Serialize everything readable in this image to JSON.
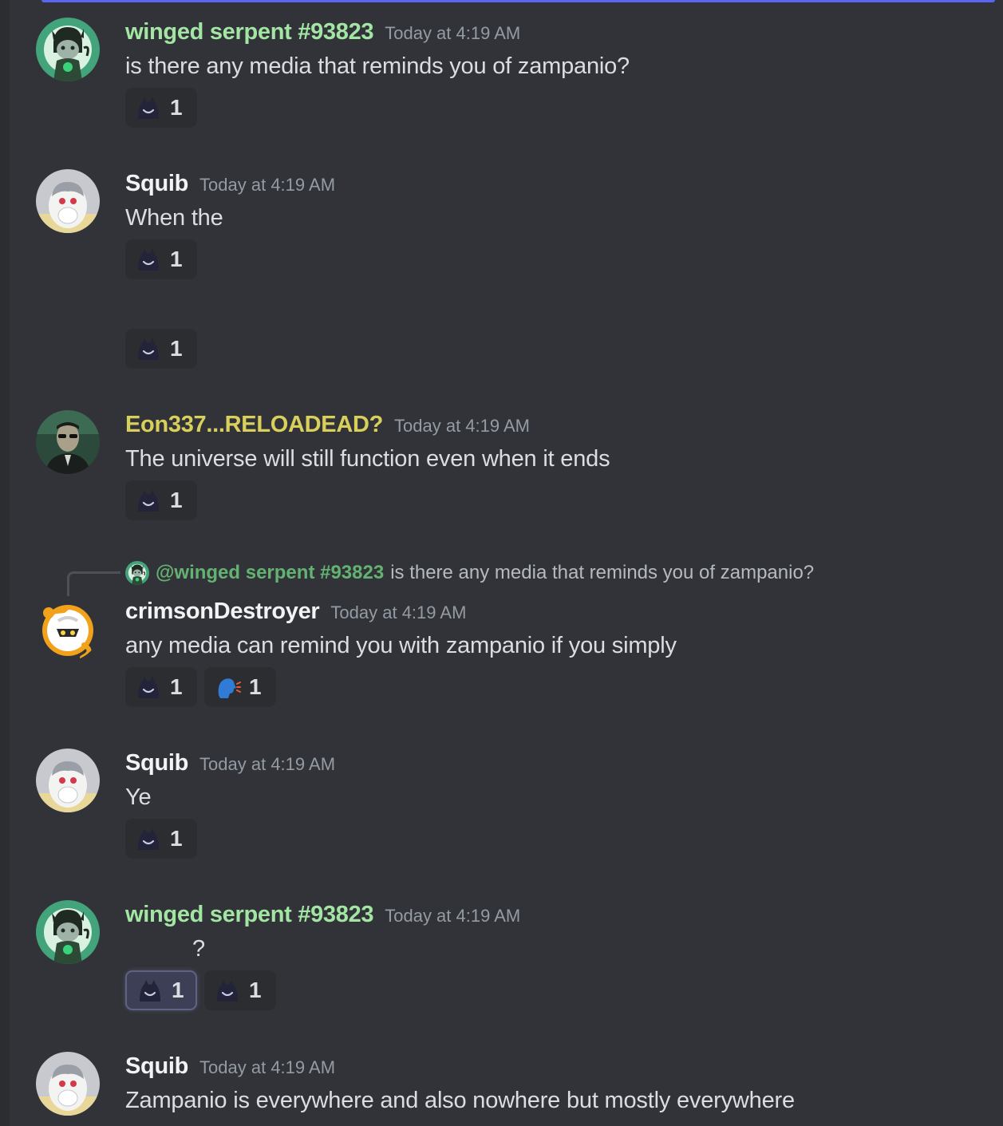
{
  "colors": {
    "background": "#313338",
    "winged_serpent": "#a3e6a4",
    "squib": "#f2f3f5",
    "eon": "#d9d05b",
    "crimson": "#f2f3f5",
    "timestamp": "#949ba4"
  },
  "messages": [
    {
      "author": "winged serpent #93823",
      "timestamp": "Today at 4:19 AM",
      "content": "is there any media that reminds you of zampanio?",
      "avatar": "winged-serpent-avatar",
      "reactions": [
        {
          "emoji": "hooded-face-emoji",
          "count": "1"
        }
      ]
    },
    {
      "author": "Squib",
      "timestamp": "Today at 4:19 AM",
      "content": "When the",
      "avatar": "squib-avatar",
      "reactions": [
        {
          "emoji": "hooded-face-emoji",
          "count": "1"
        }
      ],
      "followup_reactions": [
        {
          "emoji": "hooded-face-emoji",
          "count": "1"
        }
      ]
    },
    {
      "author": "Eon337...RELOADEAD?",
      "timestamp": "Today at 4:19 AM",
      "content": "The universe will still function even when it ends",
      "avatar": "eon-avatar",
      "reactions": [
        {
          "emoji": "hooded-face-emoji",
          "count": "1"
        }
      ]
    },
    {
      "reply": {
        "mention": "@winged serpent #93823",
        "text": "is there any media that reminds you of zampanio?"
      },
      "author": "crimsonDestroyer",
      "timestamp": "Today at 4:19 AM",
      "content": "any media can remind you with zampanio if you simply",
      "avatar": "crimson-avatar",
      "reactions": [
        {
          "emoji": "hooded-face-emoji",
          "count": "1"
        },
        {
          "emoji": "speaking-head-emoji",
          "count": "1"
        }
      ]
    },
    {
      "author": "Squib",
      "timestamp": "Today at 4:19 AM",
      "content": "Ye",
      "avatar": "squib-avatar",
      "reactions": [
        {
          "emoji": "hooded-face-emoji",
          "count": "1"
        }
      ]
    },
    {
      "author": "winged serpent #93823",
      "timestamp": "Today at 4:19 AM",
      "content": "?",
      "avatar": "winged-serpent-avatar",
      "reactions": [
        {
          "emoji": "hooded-face-emoji",
          "count": "1",
          "active": true
        },
        {
          "emoji": "hooded-face-emoji",
          "count": "1"
        }
      ]
    },
    {
      "author": "Squib",
      "timestamp": "Today at 4:19 AM",
      "content": "Zampanio is everywhere and also nowhere but mostly everywhere",
      "avatar": "squib-avatar",
      "reactions": []
    }
  ]
}
